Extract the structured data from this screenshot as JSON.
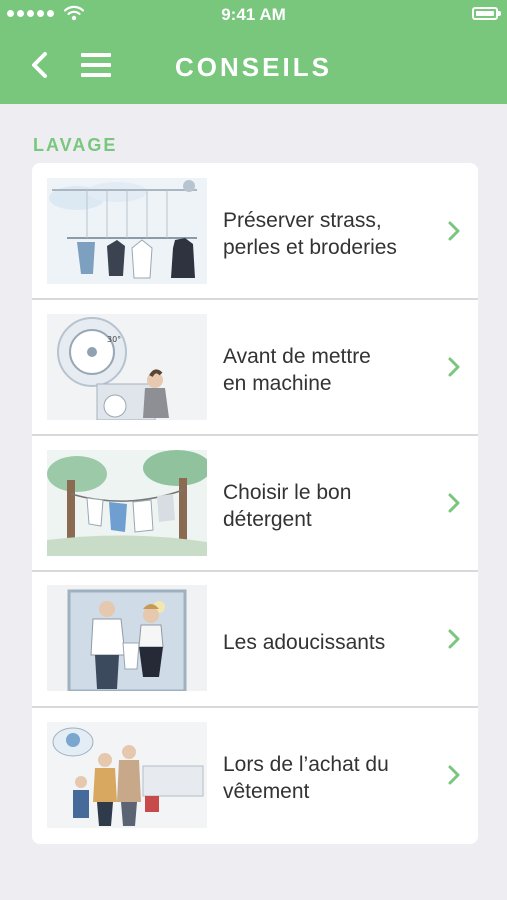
{
  "status_bar": {
    "time": "9:41 AM",
    "signal_icon": "signal-dots-icon",
    "wifi_icon": "wifi-icon",
    "battery_icon": "battery-icon"
  },
  "header": {
    "title": "CONSEILS",
    "back_icon": "chevron-left-icon",
    "menu_icon": "hamburger-menu-icon",
    "background_color": "#79c67d"
  },
  "section": {
    "title": "LAVAGE",
    "items": [
      {
        "line1": "Préserver strass,",
        "line2": "perles et broderies",
        "thumbnail": "laundry-drying-rack-illustration"
      },
      {
        "line1": "Avant de mettre",
        "line2": "en machine",
        "thumbnail": "washing-machine-illustration"
      },
      {
        "line1": "Choisir le bon",
        "line2": "détergent",
        "thumbnail": "clothesline-trees-illustration"
      },
      {
        "line1": "Les adoucissants",
        "line2": "",
        "thumbnail": "couple-doorway-illustration"
      },
      {
        "line1": "Lors de l’achat du",
        "line2": "vêtement",
        "thumbnail": "shopping-clothes-illustration"
      }
    ]
  },
  "colors": {
    "accent": "#79c67d",
    "background": "#eeeef2",
    "card": "#ffffff",
    "text": "#333333"
  }
}
